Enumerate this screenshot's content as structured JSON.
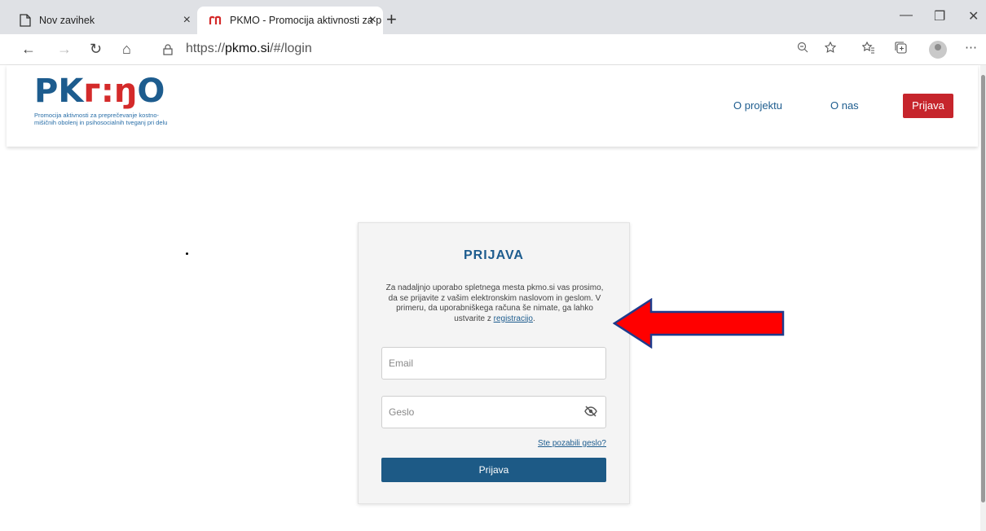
{
  "browser": {
    "tabs": [
      {
        "label": "Nov zavihek",
        "close": "×",
        "active": false
      },
      {
        "label": "PKMO - Promocija aktivnosti za p",
        "close": "×",
        "active": true
      }
    ],
    "new_tab": "+",
    "window_controls": {
      "minimize": "—",
      "restore": "❐",
      "close": "✕"
    },
    "nav": {
      "back": "←",
      "forward": "→",
      "reload": "↻",
      "home": "⌂"
    },
    "url_prefix": "https://",
    "url_domain": "pkmo.si",
    "url_path": "/#/login"
  },
  "site": {
    "logo": {
      "pk": "PK",
      "mid": "ᴦ:ŋ",
      "o": "O"
    },
    "tagline": "Promocija aktivnosti za preprečevanje kostno-mišičnih obolenj in psihosocialnih tveganj pri delu",
    "nav": {
      "projekt": "O projektu",
      "nas": "O nas",
      "prijava": "Prijava"
    }
  },
  "login": {
    "title": "PRIJAVA",
    "description_before": "Za nadaljnjo uporabo spletnega mesta pkmo.si vas prosimo, da se prijavite z vašim elektronskim naslovom in geslom. V primeru, da uporabniškega računa še nimate, ga lahko ustvarite z ",
    "register_link": "registracijo",
    "description_after": ".",
    "email_placeholder": "Email",
    "password_placeholder": "Geslo",
    "forgot": "Ste pozabili geslo?",
    "submit": "Prijava"
  },
  "colors": {
    "brand_blue": "#1d5c8e",
    "brand_red": "#c6252c",
    "arrow_red": "#ff0000",
    "arrow_outline": "#1f3b8c"
  }
}
